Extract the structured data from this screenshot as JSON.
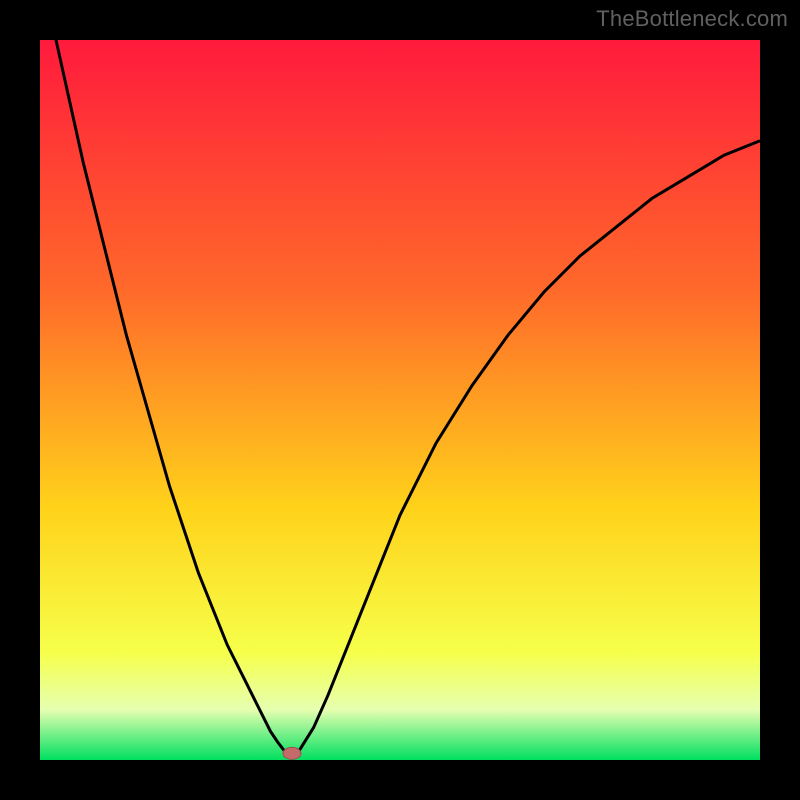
{
  "watermark": "TheBottleneck.com",
  "colors": {
    "gradient_top": "#ff1a3c",
    "gradient_mid1": "#ff6a2a",
    "gradient_mid2": "#ffd21a",
    "gradient_bottom_yellow": "#f6ff4a",
    "gradient_pale": "#e6ffb0",
    "gradient_green": "#00e060",
    "curve": "#000000",
    "marker_fill": "#c46a6a",
    "marker_stroke": "#a04a4a"
  },
  "chart_data": {
    "type": "line",
    "title": "",
    "xlabel": "",
    "ylabel": "",
    "xlim": [
      0,
      100
    ],
    "ylim": [
      0,
      100
    ],
    "x": [
      0,
      2,
      4,
      6,
      8,
      10,
      12,
      14,
      16,
      18,
      20,
      22,
      24,
      26,
      28,
      30,
      31,
      32,
      33,
      34,
      35,
      36,
      38,
      40,
      42,
      44,
      46,
      48,
      50,
      55,
      60,
      65,
      70,
      75,
      80,
      85,
      90,
      95,
      100
    ],
    "values": [
      110,
      101,
      92,
      83,
      75,
      67,
      59,
      52,
      45,
      38,
      32,
      26,
      21,
      16,
      12,
      8,
      6,
      4,
      2.5,
      1.2,
      0.5,
      1.3,
      4.5,
      9,
      14,
      19,
      24,
      29,
      34,
      44,
      52,
      59,
      65,
      70,
      74,
      78,
      81,
      84,
      86
    ],
    "marker": {
      "x": 35,
      "y": 0.5
    },
    "notes": "V-shaped bottleneck curve; minimum near x≈35. Axes unlabeled; values estimated from pixel positions."
  }
}
